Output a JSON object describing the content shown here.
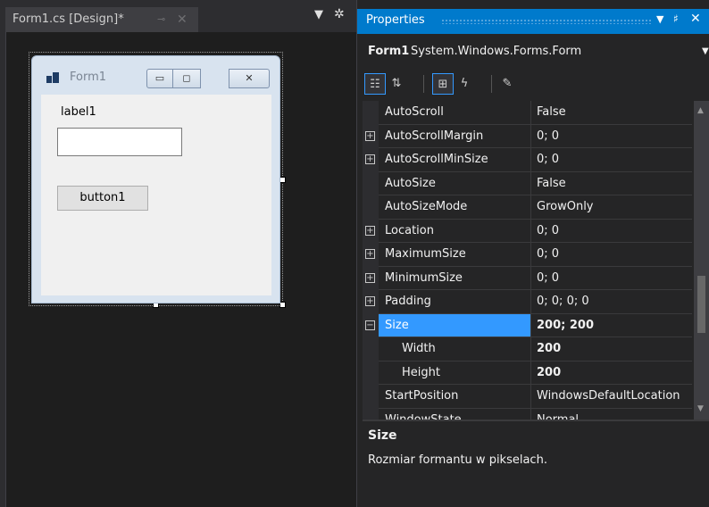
{
  "designer": {
    "tab_title": "Form1.cs [Design]*",
    "tab_pin": "⊸",
    "tab_close": "✕",
    "dropdown_glyph": "▼",
    "gear_glyph": "✲",
    "form": {
      "title": "Form1",
      "min_glyph": "▭",
      "max_glyph": "◻",
      "close_glyph": "✕",
      "label1": "label1",
      "textbox1": "",
      "button1": "button1"
    }
  },
  "properties": {
    "title": "Properties",
    "dropdown_glyph": "▼",
    "pin_glyph": "♯",
    "close_glyph": "✕",
    "object_name": "Form1",
    "object_type": "System.Windows.Forms.Form",
    "toolbar": [
      {
        "name": "categorized-icon",
        "glyph": "☷",
        "active": true
      },
      {
        "name": "alphabetical-icon",
        "glyph": "⇅",
        "active": false
      },
      {
        "name": "properties-icon",
        "glyph": "⊞",
        "active": true
      },
      {
        "name": "events-icon",
        "glyph": "ϟ",
        "active": false
      },
      {
        "name": "property-pages-icon",
        "glyph": "✎",
        "active": false
      }
    ],
    "rows": [
      {
        "name": "AutoScroll",
        "value": "False",
        "expander": "",
        "sub": false,
        "selected": false,
        "bold": false
      },
      {
        "name": "AutoScrollMargin",
        "value": "0; 0",
        "expander": "+",
        "sub": false,
        "selected": false,
        "bold": false
      },
      {
        "name": "AutoScrollMinSize",
        "value": "0; 0",
        "expander": "+",
        "sub": false,
        "selected": false,
        "bold": false
      },
      {
        "name": "AutoSize",
        "value": "False",
        "expander": "",
        "sub": false,
        "selected": false,
        "bold": false
      },
      {
        "name": "AutoSizeMode",
        "value": "GrowOnly",
        "expander": "",
        "sub": false,
        "selected": false,
        "bold": false
      },
      {
        "name": "Location",
        "value": "0; 0",
        "expander": "+",
        "sub": false,
        "selected": false,
        "bold": false
      },
      {
        "name": "MaximumSize",
        "value": "0; 0",
        "expander": "+",
        "sub": false,
        "selected": false,
        "bold": false
      },
      {
        "name": "MinimumSize",
        "value": "0; 0",
        "expander": "+",
        "sub": false,
        "selected": false,
        "bold": false
      },
      {
        "name": "Padding",
        "value": "0; 0; 0; 0",
        "expander": "+",
        "sub": false,
        "selected": false,
        "bold": false
      },
      {
        "name": "Size",
        "value": "200; 200",
        "expander": "−",
        "sub": false,
        "selected": true,
        "bold": true
      },
      {
        "name": "Width",
        "value": "200",
        "expander": "",
        "sub": true,
        "selected": false,
        "bold": true
      },
      {
        "name": "Height",
        "value": "200",
        "expander": "",
        "sub": true,
        "selected": false,
        "bold": true
      },
      {
        "name": "StartPosition",
        "value": "WindowsDefaultLocation",
        "expander": "",
        "sub": false,
        "selected": false,
        "bold": false
      },
      {
        "name": "WindowState",
        "value": "Normal",
        "expander": "",
        "sub": false,
        "selected": false,
        "bold": false
      }
    ],
    "scroll_up": "▲",
    "scroll_down": "▼",
    "desc_title": "Size",
    "desc_text": "Rozmiar formantu w pikselach."
  }
}
